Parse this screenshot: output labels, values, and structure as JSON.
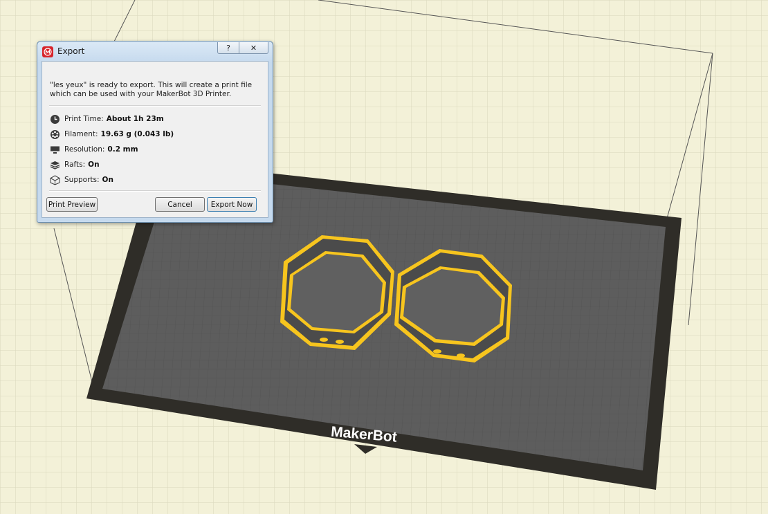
{
  "scene": {
    "brand_label": "MakerBot",
    "background_color": "#f3f1d8",
    "plate_color": "#5d5d5d",
    "plate_border_color": "#2f2d28",
    "model_color": "#595959",
    "selection_color": "#f7c51e"
  },
  "dialog": {
    "title": "Export",
    "help_label": "?",
    "close_label": "✕",
    "message": "\"les yeux\" is ready to export. This will create a print file which can be used with your MakerBot 3D Printer.",
    "info": [
      {
        "icon": "clock-icon",
        "label": "Print Time:",
        "value": "About 1h 23m"
      },
      {
        "icon": "filament-spool-icon",
        "label": "Filament:",
        "value": "19.63 g (0.043 lb)"
      },
      {
        "icon": "resolution-icon",
        "label": "Resolution:",
        "value": "0.2 mm"
      },
      {
        "icon": "rafts-layers-icon",
        "label": "Rafts:",
        "value": "On"
      },
      {
        "icon": "supports-cube-icon",
        "label": "Supports:",
        "value": "On"
      }
    ],
    "buttons": {
      "print_preview": "Print Preview",
      "cancel": "Cancel",
      "export_now": "Export Now"
    }
  }
}
